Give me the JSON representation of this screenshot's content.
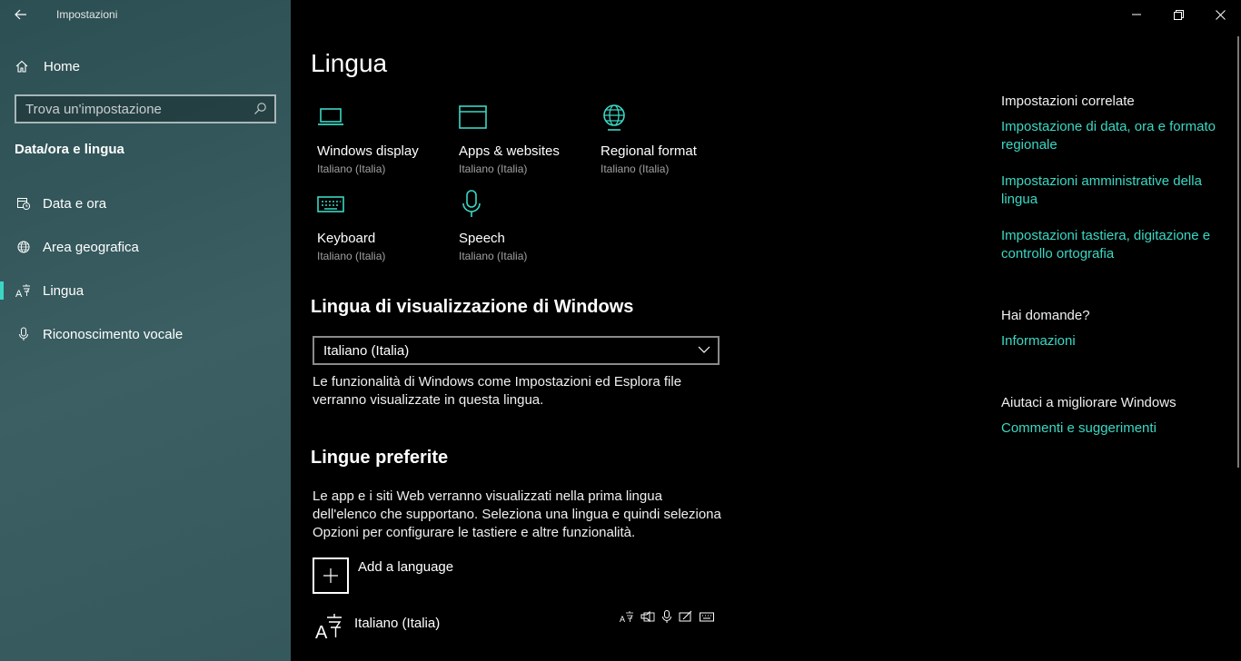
{
  "window": {
    "title": "Impostazioni"
  },
  "sidebar": {
    "home_label": "Home",
    "search_placeholder": "Trova un'impostazione",
    "section_title": "Data/ora e lingua",
    "items": [
      {
        "label": "Data e ora",
        "icon": "clock-calendar-icon"
      },
      {
        "label": "Area geografica",
        "icon": "globe-icon"
      },
      {
        "label": "Lingua",
        "icon": "language-icon",
        "active": true
      },
      {
        "label": "Riconoscimento vocale",
        "icon": "microphone-icon"
      }
    ]
  },
  "main": {
    "title": "Lingua",
    "tiles": [
      {
        "label": "Windows display",
        "sub": "Italiano (Italia)",
        "icon": "laptop-icon"
      },
      {
        "label": "Apps & websites",
        "sub": "Italiano (Italia)",
        "icon": "browser-window-icon"
      },
      {
        "label": "Regional format",
        "sub": "Italiano (Italia)",
        "icon": "globe-icon"
      },
      {
        "label": "Keyboard",
        "sub": "Italiano (Italia)",
        "icon": "keyboard-icon"
      },
      {
        "label": "Speech",
        "sub": "Italiano (Italia)",
        "icon": "microphone-icon"
      }
    ],
    "display_lang": {
      "heading": "Lingua di visualizzazione di Windows",
      "selected": "Italiano (Italia)",
      "description": "Le funzionalità di Windows come Impostazioni ed Esplora file verranno visualizzate in questa lingua."
    },
    "preferred": {
      "heading": "Lingue preferite",
      "description": "Le app e i siti Web verranno visualizzati nella prima lingua dell'elenco che supportano. Seleziona una lingua e quindi seleziona Opzioni per configurare le tastiere e altre funzionalità.",
      "add_label": "Add a language",
      "languages": [
        {
          "name": "Italiano (Italia)"
        }
      ]
    }
  },
  "related": {
    "heading": "Impostazioni correlate",
    "links": [
      "Impostazione di data, ora e formato regionale",
      "Impostazioni amministrative della lingua",
      "Impostazioni tastiera, digitazione e controllo ortografia"
    ],
    "questions_heading": "Hai domande?",
    "questions_link": "Informazioni",
    "improve_heading": "Aiutaci a migliorare Windows",
    "improve_link": "Commenti e suggerimenti"
  },
  "colors": {
    "accent": "#3ad8c4",
    "background": "#000000",
    "sidebar": "#35585c"
  }
}
